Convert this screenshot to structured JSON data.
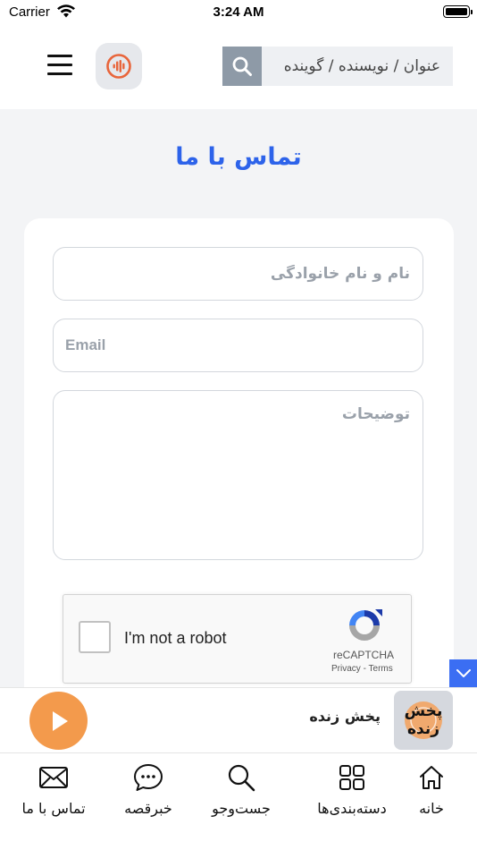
{
  "status_bar": {
    "carrier": "Carrier",
    "time": "3:24 AM"
  },
  "header": {
    "search_placeholder": "عنوان / نویسنده / گوینده",
    "menu_icon": "hamburger-icon",
    "logo_icon": "audio-wave-icon"
  },
  "page": {
    "title": "تماس با ما"
  },
  "form": {
    "name_placeholder": "نام و نام خانوادگی",
    "email_placeholder": "Email",
    "description_placeholder": "توضیحات"
  },
  "recaptcha": {
    "label": "I'm not a robot",
    "brand": "reCAPTCHA",
    "privacy": "Privacy",
    "separator": " - ",
    "terms": "Terms"
  },
  "player": {
    "title": "پخش زنده",
    "logo_text_top": "پخش",
    "logo_text_bottom": "زنده"
  },
  "bottom_nav": {
    "items": [
      {
        "label": "خانه",
        "icon": "home-icon"
      },
      {
        "label": "دسته‌بندی‌ها",
        "icon": "grid-icon"
      },
      {
        "label": "جست‌وجو",
        "icon": "search-icon"
      },
      {
        "label": "خبرقصه",
        "icon": "chat-icon"
      },
      {
        "label": "تماس با ما",
        "icon": "mail-icon"
      }
    ]
  },
  "colors": {
    "accent": "#2d63ea",
    "play_button": "#f39a4c",
    "search_button": "#8e9aa7",
    "page_background": "#f3f4f6",
    "scroll_button": "#3b6ef3"
  }
}
